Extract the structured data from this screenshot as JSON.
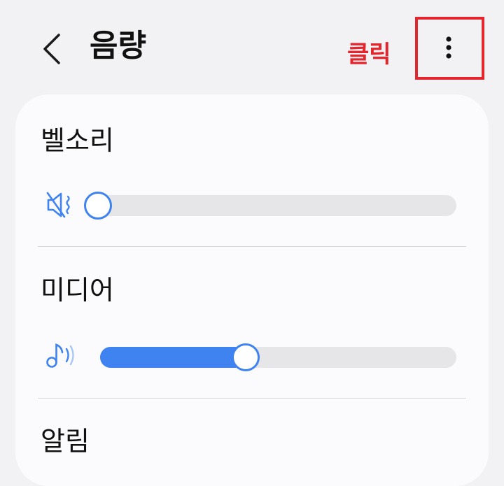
{
  "header": {
    "title": "음량",
    "back_icon": "chevron-left-icon",
    "more_icon": "more-vert-icon"
  },
  "annotation": {
    "label": "클릭",
    "color": "#e3252e"
  },
  "sections": [
    {
      "label": "벨소리",
      "icon": "ring-mute-icon",
      "level_percent": 0
    },
    {
      "label": "미디어",
      "icon": "media-note-icon",
      "level_percent": 40
    },
    {
      "label": "알림"
    }
  ],
  "colors": {
    "accent": "#3f83f0",
    "track": "#e6e6e8",
    "background": "#f2f2f4",
    "card": "#fbfbfd"
  }
}
